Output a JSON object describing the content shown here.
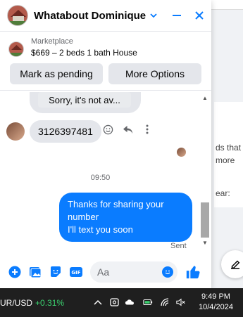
{
  "header": {
    "title": "Whatabout Dominique",
    "accent": "#0a7cff"
  },
  "listing": {
    "category": "Marketplace",
    "description": "$669 – 2 beds 1 bath House"
  },
  "actions": {
    "pending_label": "Mark as pending",
    "more_label": "More Options"
  },
  "messages": {
    "quoted": "Sorry, it's not av...",
    "incoming": "3126397481",
    "time": "09:50",
    "outgoing_line1": "Thanks for sharing your number",
    "outgoing_line2": "I'll text you soon",
    "status": "Sent"
  },
  "composer": {
    "placeholder": "Aa"
  },
  "background": {
    "snippet1": "ds that",
    "snippet2": "more",
    "snippet3": "ear:"
  },
  "taskbar": {
    "pair": "UR/USD",
    "change": "+0.31%",
    "time": "9:49 PM",
    "date": "10/4/2024"
  }
}
